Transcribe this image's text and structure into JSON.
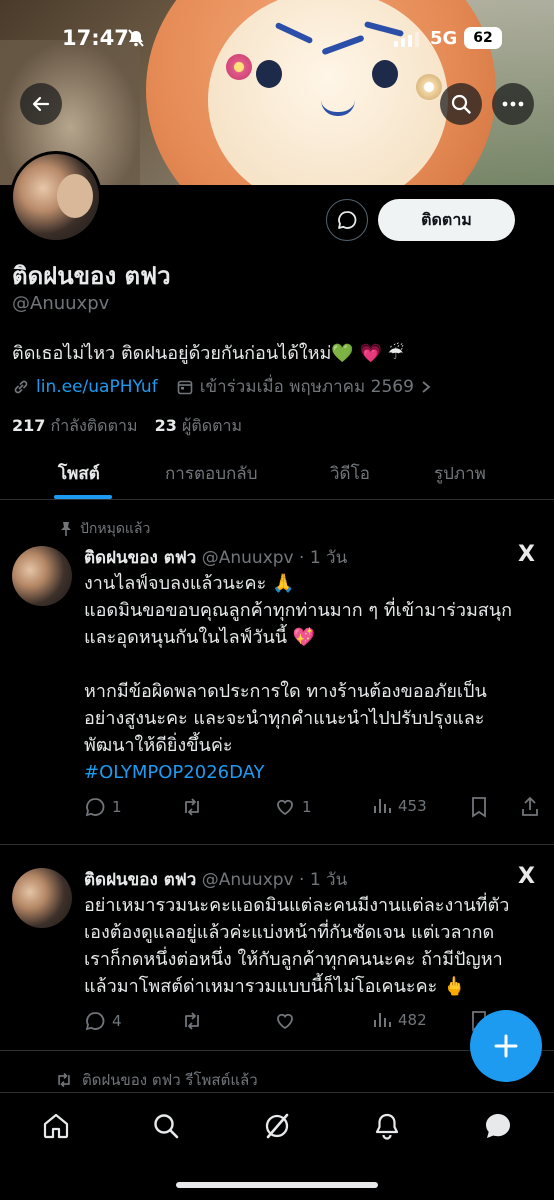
{
  "status_bar": {
    "time": "17:47",
    "network": "5G",
    "battery": "62"
  },
  "profile": {
    "follow_label": "ติดตาม",
    "display_name": "ติดฝนของ ตฟว",
    "handle": "@Anuuxpv",
    "bio": "ติดเธอไม่ไหว ติดฝนอยู่ด้วยกันก่อนได้ใหม่💚 💗 ☔",
    "link": "lin.ee/uaPHYuf",
    "joined": "เข้าร่วมเมื่อ พฤษภาคม 2569",
    "following_count": "217",
    "following_label": "กำลังติดตาม",
    "followers_count": "23",
    "followers_label": "ผู้ติดตาม"
  },
  "tabs": [
    {
      "label": "โพสต์"
    },
    {
      "label": "การตอบกลับ"
    },
    {
      "label": "วิดีโอ"
    },
    {
      "label": "รูปภาพ"
    }
  ],
  "pinned_label": "ปักหมุดแล้ว",
  "posts": [
    {
      "name": "ติดฝนของ ตฟว",
      "handle_time": "@Anuuxpv · 1 วัน",
      "lines": [
        "งานไลฟ์จบลงแล้วนะคะ 🙏",
        "แอดมินขอขอบคุณลูกค้าทุกท่านมาก ๆ ที่เข้ามาร่วมสนุก",
        "และอุดหนุนกันในไลฟ์วันนี้ 💖",
        "",
        "หากมีข้อผิดพลาดประการใด ทางร้านต้องขออภัยเป็น",
        "อย่างสูงนะคะ และจะนำทุกคำแนะนำไปปรับปรุงและ",
        "พัฒนาให้ดียิ่งขึ้นค่ะ"
      ],
      "hashtag": "#OLYMPOP2026DAY",
      "replies": "1",
      "reposts": "",
      "likes": "1",
      "views": "453"
    },
    {
      "name": "ติดฝนของ ตฟว",
      "handle_time": "@Anuuxpv · 1 วัน",
      "lines": [
        "อย่าเหมารวมนะคะแอดมินแต่ละคนมีงานแต่ละงานที่ตัว",
        "เองต้องดูแลอยู่แล้วค่ะแบ่งหน้าที่กันชัดเจน แต่เวลากด",
        "เราก็กดหนึ่งต่อหนึ่ง ให้กับลูกค้าทุกคนนะคะ ถ้ามีปัญหา",
        "แล้วมาโพสต์ด่าเหมารวมแบบนี้ก็ไม่โอเคนะคะ 🖕"
      ],
      "replies": "4",
      "reposts": "",
      "likes": "",
      "views": "482"
    }
  ],
  "repost_note": "ติดฝนของ ตฟว รีโพสต์แล้ว",
  "x_logo": "X"
}
